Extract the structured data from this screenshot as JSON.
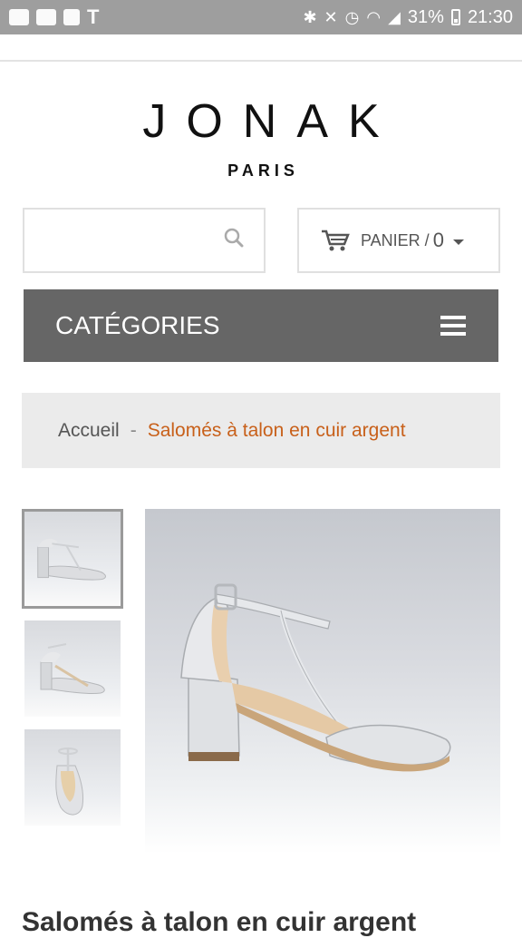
{
  "status_bar": {
    "battery": "31%",
    "time": "21:30",
    "left_icons": [
      "message-icon",
      "gmail-icon",
      "gallery-icon",
      "t-icon"
    ],
    "right_icons": [
      "bluetooth-icon",
      "mute-icon",
      "alarm-icon",
      "wifi-icon",
      "signal-icon",
      "battery-icon"
    ]
  },
  "brand": {
    "name": "JONAK",
    "city": "PARIS"
  },
  "search": {
    "placeholder": "",
    "icon": "search-icon"
  },
  "cart": {
    "label": "PANIER /",
    "count": "0",
    "icon": "cart-icon"
  },
  "nav": {
    "categories_label": "CATÉGORIES",
    "menu_icon": "hamburger-icon"
  },
  "breadcrumb": {
    "home": "Accueil",
    "separator": "-",
    "current": "Salomés à talon en cuir argent"
  },
  "product": {
    "title": "Salomés à talon en cuir argent",
    "thumbnails": [
      "thumbnail-1",
      "thumbnail-2",
      "thumbnail-3"
    ]
  },
  "colors": {
    "nav_bg": "#666666",
    "breadcrumb_bg": "#ebebeb",
    "breadcrumb_current": "#c8601a",
    "status_bar_bg": "#9e9e9e"
  }
}
